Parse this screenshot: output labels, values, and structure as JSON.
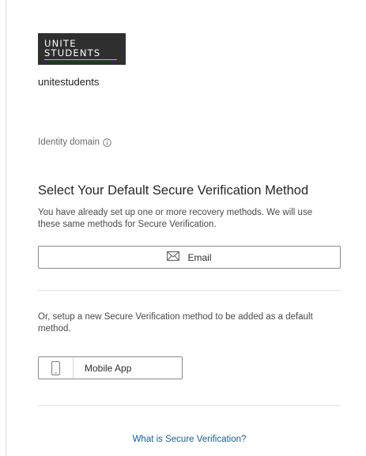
{
  "brand": {
    "logo_line1": "UNITE",
    "logo_line2": "STUDENTS",
    "tenant_name": "unitestudents"
  },
  "identity": {
    "label": "Identity domain",
    "info_icon": "info-circle-icon"
  },
  "verification": {
    "heading": "Select Your Default Secure Verification Method",
    "description": "You have already set up one or more recovery methods. We will use these same methods for Secure Verification.",
    "email_label": "Email",
    "email_icon": "envelope-icon"
  },
  "setup": {
    "text": "Or, setup a new Secure Verification method to be added as a default method.",
    "mobile_label": "Mobile App",
    "mobile_icon": "smartphone-icon"
  },
  "help": {
    "link_text": "What is Secure Verification?"
  },
  "colors": {
    "logo_bg": "#2f2f2f",
    "logo_accent": "#d9b64a",
    "link": "#1d5c8c",
    "border": "#8a8a8a"
  }
}
